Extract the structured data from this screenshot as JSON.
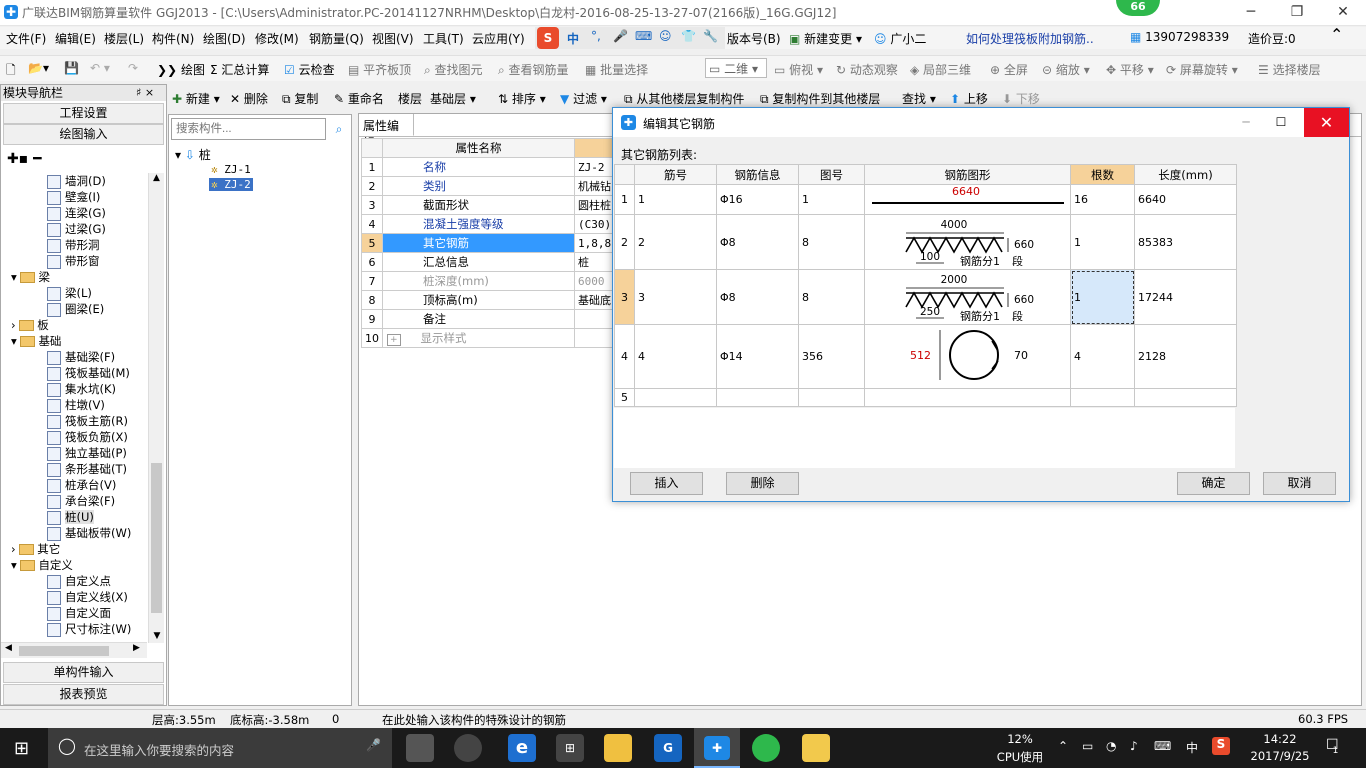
{
  "window": {
    "title": "广联达BIM钢筋算量软件 GGJ2013 - [C:\\Users\\Administrator.PC-20141127NRHM\\Desktop\\白龙村-2016-08-25-13-27-07(2166版)_16G.GGJ12]",
    "badge": "66"
  },
  "menu": {
    "items": [
      "文件(F)",
      "编辑(E)",
      "楼层(L)",
      "构件(N)",
      "绘图(D)",
      "修改(M)",
      "钢筋量(Q)",
      "视图(V)",
      "工具(T)",
      "云应用(Y)"
    ],
    "ime": "中",
    "version": "版本号(B)",
    "new_change": "新建变更",
    "assistant": "广小二",
    "help_link": "如何处理筏板附加钢筋..",
    "phone": "13907298339",
    "cost": "造价豆:0"
  },
  "toolbar": {
    "draw": "绘图",
    "sum": "汇总计算",
    "cloud_check": "云检查",
    "level_slab": "平齐板顶",
    "find_elem": "查找图元",
    "view_rebar": "查看钢筋量",
    "batch_select": "批量选择",
    "view_mode": "二维",
    "top_view": "俯视",
    "dynamic": "动态观察",
    "local_3d": "局部三维",
    "fullscreen": "全屏",
    "zoom": "缩放",
    "pan": "平移",
    "rotate": "屏幕旋转",
    "select_floor": "选择楼层"
  },
  "toolbar2": {
    "new": "新建",
    "delete": "删除",
    "copy": "复制",
    "rename": "重命名",
    "floor_label": "楼层",
    "floor_value": "基础层",
    "sort": "排序",
    "filter": "过滤",
    "copy_from": "从其他楼层复制构件",
    "copy_to": "复制构件到其他楼层",
    "find": "查找",
    "up": "上移",
    "down": "下移"
  },
  "left_panel": {
    "header": "模块导航栏",
    "pin": "♯ ×",
    "project_settings": "工程设置",
    "drawing_input": "绘图输入",
    "single_input": "单构件输入",
    "report_preview": "报表预览",
    "tree": [
      {
        "label": "墙洞(D)",
        "type": "item",
        "indent": 2
      },
      {
        "label": "壁龛(I)",
        "type": "item",
        "indent": 2
      },
      {
        "label": "连梁(G)",
        "type": "item",
        "indent": 2
      },
      {
        "label": "过梁(G)",
        "type": "item",
        "indent": 2
      },
      {
        "label": "带形洞",
        "type": "item",
        "indent": 2
      },
      {
        "label": "带形窗",
        "type": "item",
        "indent": 2
      },
      {
        "label": "梁",
        "type": "folder",
        "indent": 1,
        "open": true
      },
      {
        "label": "梁(L)",
        "type": "item",
        "indent": 2
      },
      {
        "label": "圈梁(E)",
        "type": "item",
        "indent": 2
      },
      {
        "label": "板",
        "type": "folder",
        "indent": 1,
        "open": false
      },
      {
        "label": "基础",
        "type": "folder",
        "indent": 1,
        "open": true
      },
      {
        "label": "基础梁(F)",
        "type": "item",
        "indent": 2
      },
      {
        "label": "筏板基础(M)",
        "type": "item",
        "indent": 2
      },
      {
        "label": "集水坑(K)",
        "type": "item",
        "indent": 2
      },
      {
        "label": "柱墩(V)",
        "type": "item",
        "indent": 2
      },
      {
        "label": "筏板主筋(R)",
        "type": "item",
        "indent": 2
      },
      {
        "label": "筏板负筋(X)",
        "type": "item",
        "indent": 2
      },
      {
        "label": "独立基础(P)",
        "type": "item",
        "indent": 2
      },
      {
        "label": "条形基础(T)",
        "type": "item",
        "indent": 2
      },
      {
        "label": "桩承台(V)",
        "type": "item",
        "indent": 2
      },
      {
        "label": "承台梁(F)",
        "type": "item",
        "indent": 2
      },
      {
        "label": "桩(U)",
        "type": "item",
        "indent": 2,
        "selected": true
      },
      {
        "label": "基础板带(W)",
        "type": "item",
        "indent": 2
      },
      {
        "label": "其它",
        "type": "folder",
        "indent": 1,
        "open": false
      },
      {
        "label": "自定义",
        "type": "folder",
        "indent": 1,
        "open": true
      },
      {
        "label": "自定义点",
        "type": "item",
        "indent": 2
      },
      {
        "label": "自定义线(X)",
        "type": "item",
        "indent": 2
      },
      {
        "label": "自定义面",
        "type": "item",
        "indent": 2
      },
      {
        "label": "尺寸标注(W)",
        "type": "item",
        "indent": 2
      }
    ]
  },
  "mid_panel": {
    "search_placeholder": "搜索构件...",
    "root": "桩",
    "children": [
      "ZJ-1",
      "ZJ-2"
    ],
    "selected": "ZJ-2"
  },
  "property": {
    "tab": "属性编辑",
    "col_name": "属性名称",
    "rows": [
      {
        "n": "1",
        "name": "名称",
        "value": "ZJ-2",
        "blue": true
      },
      {
        "n": "2",
        "name": "类别",
        "value": "机械钻",
        "blue": true
      },
      {
        "n": "3",
        "name": "截面形状",
        "value": "圆柱桩",
        "blue": false
      },
      {
        "n": "4",
        "name": "混凝土强度等级",
        "value": "(C30)",
        "blue": true
      },
      {
        "n": "5",
        "name": "其它钢筋",
        "value": "1,8,8,:",
        "blue": false,
        "selected": true
      },
      {
        "n": "6",
        "name": "汇总信息",
        "value": "桩",
        "blue": false
      },
      {
        "n": "7",
        "name": "桩深度(mm)",
        "value": "6000",
        "blue": false,
        "grey": true
      },
      {
        "n": "8",
        "name": "顶标高(m)",
        "value": "基础底",
        "blue": false
      },
      {
        "n": "9",
        "name": "备注",
        "value": "",
        "blue": false
      },
      {
        "n": "10",
        "name": "显示样式",
        "value": "",
        "blue": false,
        "grey": true,
        "expand": "+"
      }
    ]
  },
  "dialog": {
    "title": "编辑其它钢筋",
    "list_label": "其它钢筋列表:",
    "headers": [
      "筋号",
      "钢筋信息",
      "图号",
      "钢筋图形",
      "根数",
      "长度(mm)"
    ],
    "rows": [
      {
        "n": "1",
        "no": "1",
        "info": "Φ16",
        "fig": "1",
        "count": "16",
        "length": "6640",
        "shape": {
          "type": "line",
          "label": "6640"
        }
      },
      {
        "n": "2",
        "no": "2",
        "info": "Φ8",
        "fig": "8",
        "count": "1",
        "length": "85383",
        "shape": {
          "type": "zigzag",
          "top": "4000",
          "pitch": "100",
          "side": "660",
          "bottom": "钢筋分1",
          "suffix": "段"
        }
      },
      {
        "n": "3",
        "no": "3",
        "info": "Φ8",
        "fig": "8",
        "count": "1",
        "length": "17244",
        "shape": {
          "type": "zigzag",
          "top": "2000",
          "pitch": "250",
          "side": "660",
          "bottom": "钢筋分1",
          "suffix": "段"
        }
      },
      {
        "n": "4",
        "no": "4",
        "info": "Φ14",
        "fig": "356",
        "count": "4",
        "length": "2128",
        "shape": {
          "type": "circle",
          "left": "512",
          "right": "70"
        }
      },
      {
        "n": "5",
        "no": "",
        "info": "",
        "fig": "",
        "count": "",
        "length": "",
        "shape": null
      }
    ],
    "buttons": {
      "insert": "插入",
      "delete": "删除",
      "ok": "确定",
      "cancel": "取消"
    }
  },
  "status": {
    "floor_height": "层高:3.55m",
    "base_elev": "底标高:-3.58m",
    "zero": "0",
    "hint": "在此处输入该构件的特殊设计的钢筋",
    "fps": "60.3 FPS"
  },
  "taskbar": {
    "search_placeholder": "在这里输入你要搜索的内容",
    "cpu_pct": "12%",
    "cpu_label": "CPU使用",
    "ime": "中",
    "time": "14:22",
    "date": "2017/9/25",
    "notif": "1"
  },
  "colors": {
    "accent": "#3399ff",
    "selected_row": "#3b8fd6",
    "orange": "#f6d29a"
  }
}
